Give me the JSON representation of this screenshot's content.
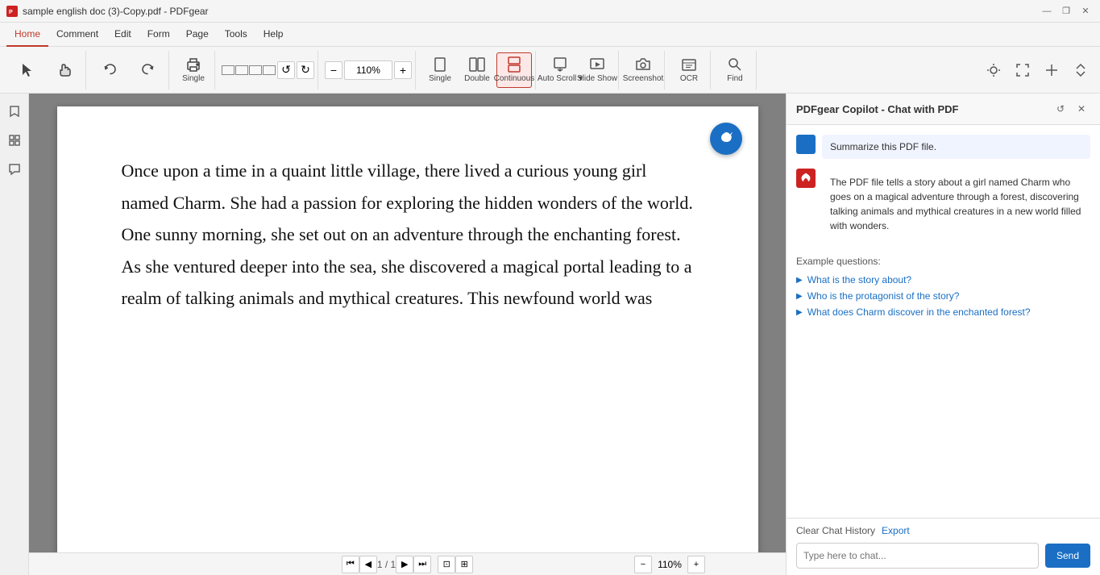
{
  "titleBar": {
    "appName": "sample english doc (3)-Copy.pdf - PDFgear",
    "icon": "pdf-icon",
    "controls": {
      "minimize": "—",
      "restore": "❐",
      "close": "✕"
    }
  },
  "menuBar": {
    "items": [
      {
        "label": "Home",
        "active": true
      },
      {
        "label": "Comment",
        "active": false
      },
      {
        "label": "Edit",
        "active": false
      },
      {
        "label": "Form",
        "active": false
      },
      {
        "label": "Page",
        "active": false
      },
      {
        "label": "Tools",
        "active": false
      },
      {
        "label": "Help",
        "active": false
      }
    ]
  },
  "toolbar": {
    "zoomValue": "110%",
    "zoomDecrease": "−",
    "zoomIncrease": "+",
    "groups": [
      {
        "name": "cursor-group",
        "tools": [
          {
            "id": "cursor",
            "label": "",
            "icon": "cursor"
          },
          {
            "id": "hand",
            "label": "",
            "icon": "hand"
          }
        ]
      },
      {
        "name": "print-group",
        "tools": [
          {
            "id": "print",
            "label": "Print",
            "icon": "print"
          }
        ]
      },
      {
        "name": "view-group",
        "tools": [
          {
            "id": "single",
            "label": "Single",
            "icon": "single"
          },
          {
            "id": "double",
            "label": "Double",
            "icon": "double"
          },
          {
            "id": "continuous",
            "label": "Continuous",
            "icon": "continuous",
            "active": true
          }
        ]
      },
      {
        "name": "scroll-group",
        "tools": [
          {
            "id": "autoscroll",
            "label": "Auto Scroll",
            "icon": "autoscroll"
          },
          {
            "id": "slideshow",
            "label": "Slide Show",
            "icon": "slideshow"
          }
        ]
      },
      {
        "name": "screenshot-group",
        "tools": [
          {
            "id": "screenshot",
            "label": "Screenshot",
            "icon": "screenshot"
          }
        ]
      },
      {
        "name": "ocr-group",
        "tools": [
          {
            "id": "ocr",
            "label": "OCR",
            "icon": "ocr"
          }
        ]
      },
      {
        "name": "find-group",
        "tools": [
          {
            "id": "find",
            "label": "Find",
            "icon": "find"
          }
        ]
      }
    ]
  },
  "pdfContent": {
    "text": "Once upon a time in a quaint little village, there lived a curious young girl named Charm. She had a passion for exploring the hidden wonders of the world. One sunny morning, she set out on an adventure through the enchanting forest. As she ventured deeper into the sea, she discovered a magical portal leading to a realm of talking animals and mythical creatures. This newfound world was"
  },
  "bottomBar": {
    "firstPage": "⏮",
    "prevPage": "◀",
    "pageInfo": "1 / 1",
    "nextPage": "▶",
    "lastPage": "⏭",
    "fitWidth": "⊡",
    "fitPage": "⊞",
    "zoomOut": "−",
    "zoomValue": "110%",
    "zoomIn": "+"
  },
  "copilot": {
    "title": "PDFgear Copilot - Chat with PDF",
    "refreshIcon": "↺",
    "closeIcon": "✕",
    "userMessage": "Summarize this PDF file.",
    "aiResponse": "The PDF file tells a story about a girl named Charm who goes on a magical adventure through a forest, discovering talking animals and mythical creatures in a new world filled with wonders.",
    "exampleQuestionsLabel": "Example questions:",
    "examples": [
      "What is the story about?",
      "Who is the protagonist of the story?",
      "What does Charm discover in the enchanted forest?"
    ],
    "clearHistory": "Clear Chat History",
    "export": "Export",
    "inputPlaceholder": "Type here to chat...",
    "sendLabel": "Send"
  }
}
